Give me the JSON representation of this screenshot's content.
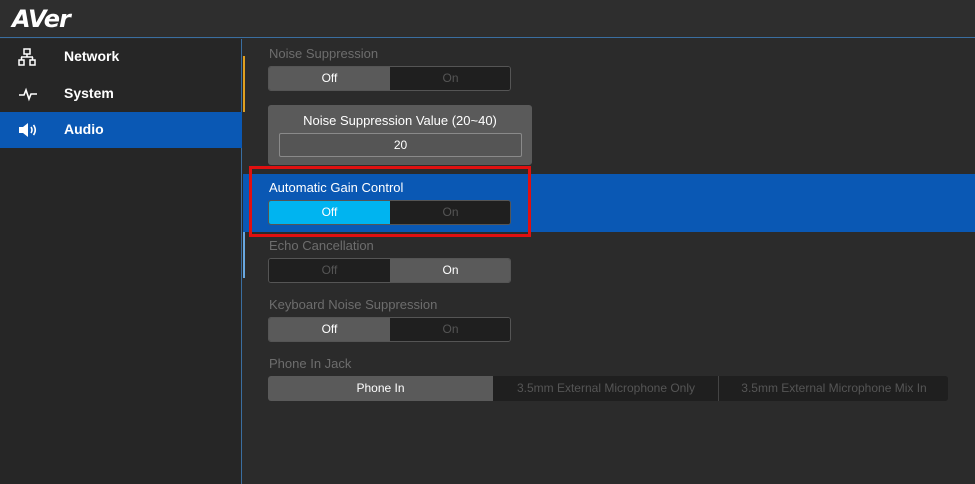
{
  "app": {
    "logo": "AVer"
  },
  "sidebar": {
    "items": [
      {
        "label": "Network",
        "icon": "network-icon"
      },
      {
        "label": "System",
        "icon": "pulse-icon"
      },
      {
        "label": "Audio",
        "icon": "speaker-icon",
        "active": true
      }
    ]
  },
  "audio": {
    "noise_suppression": {
      "label": "Noise Suppression",
      "off": "Off",
      "on": "On",
      "selected": "Off"
    },
    "noise_value": {
      "title": "Noise Suppression Value (20~40)",
      "value": "20"
    },
    "agc": {
      "label": "Automatic Gain Control",
      "off": "Off",
      "on": "On",
      "selected": "Off"
    },
    "echo": {
      "label": "Echo Cancellation",
      "off": "Off",
      "on": "On",
      "selected": "On"
    },
    "keyboard_noise": {
      "label": "Keyboard Noise Suppression",
      "off": "Off",
      "on": "On",
      "selected": "Off"
    },
    "phone_in_jack": {
      "label": "Phone In Jack",
      "options": [
        "Phone In",
        "3.5mm External Microphone Only",
        "3.5mm External Microphone Mix In"
      ],
      "selected": "Phone In"
    }
  },
  "colors": {
    "accent": "#0a58b4",
    "highlight_button": "#00b4f0",
    "annotation_box": "#e01010",
    "indicator": "#e0a020"
  }
}
